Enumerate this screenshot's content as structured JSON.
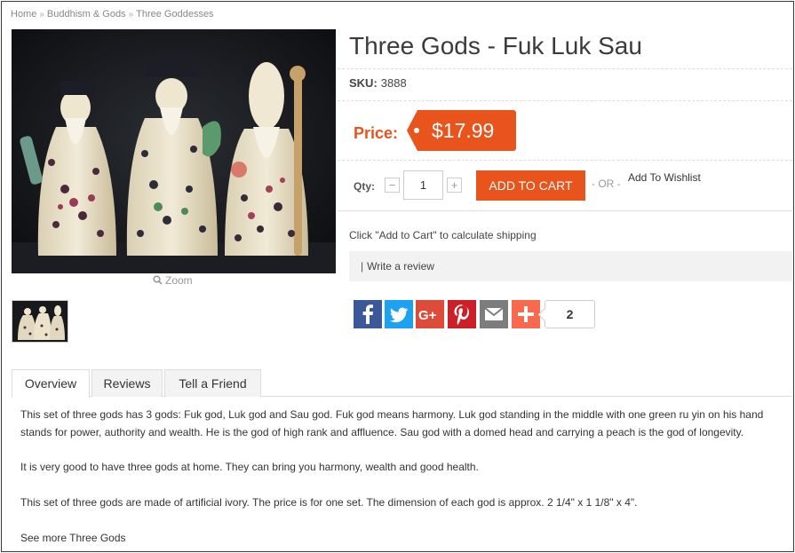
{
  "breadcrumb": {
    "items": [
      "Home",
      "Buddhism & Gods",
      "Three Goddesses"
    ]
  },
  "product": {
    "title": "Three Gods - Fuk Luk Sau",
    "sku_label": "SKU:",
    "sku_value": "3888",
    "price_label": "Price:",
    "price": "$17.99",
    "zoom_label": "Zoom"
  },
  "purchase": {
    "qty_label": "Qty:",
    "qty_minus": "−",
    "qty_plus": "+",
    "qty_value": "1",
    "add_to_cart": "ADD TO CART",
    "or_text": "- OR -",
    "wishlist": "Add To Wishlist"
  },
  "shipping_note": "Click \"Add to Cart\" to calculate shipping",
  "review": {
    "pipe": "|",
    "label": "Write a review"
  },
  "share": {
    "buttons": [
      {
        "icon": "facebook-icon",
        "color": "#3b5998"
      },
      {
        "icon": "twitter-icon",
        "color": "#1da1f2"
      },
      {
        "icon": "google-plus-icon",
        "color": "#dd4b39"
      },
      {
        "icon": "pinterest-icon",
        "color": "#cb2027"
      },
      {
        "icon": "email-icon",
        "color": "#7d7d7d"
      },
      {
        "icon": "addthis-plus-icon",
        "color": "#f8694d"
      }
    ],
    "count": "2"
  },
  "tabs": [
    {
      "label": "Overview",
      "active": true
    },
    {
      "label": "Reviews",
      "active": false
    },
    {
      "label": "Tell a Friend",
      "active": false
    }
  ],
  "description": {
    "p1_line1": "This set of three gods has 3 gods: Fuk god, Luk god and Sau god. Fuk god means harmony. Luk god standing in the middle with one green ru yin on his hand",
    "p1_line2": "stands for power, authority and wealth. He is the god of high rank and affluence. Sau god with a domed head and carrying a peach is the god of longevity.",
    "p2": "It is very good to have three gods at home. They can bring you harmony, wealth and good health.",
    "p3": "This set of three gods are made of artificial ivory. The price is for one set. The dimension of each god is approx. 2 1/4\" x 1 1/8\" x 4\".",
    "more_link": "See more Three Gods"
  },
  "colors": {
    "accent": "#e8541c",
    "frame": "#3a3a3a",
    "tab_bg": "#f3f3f3"
  }
}
